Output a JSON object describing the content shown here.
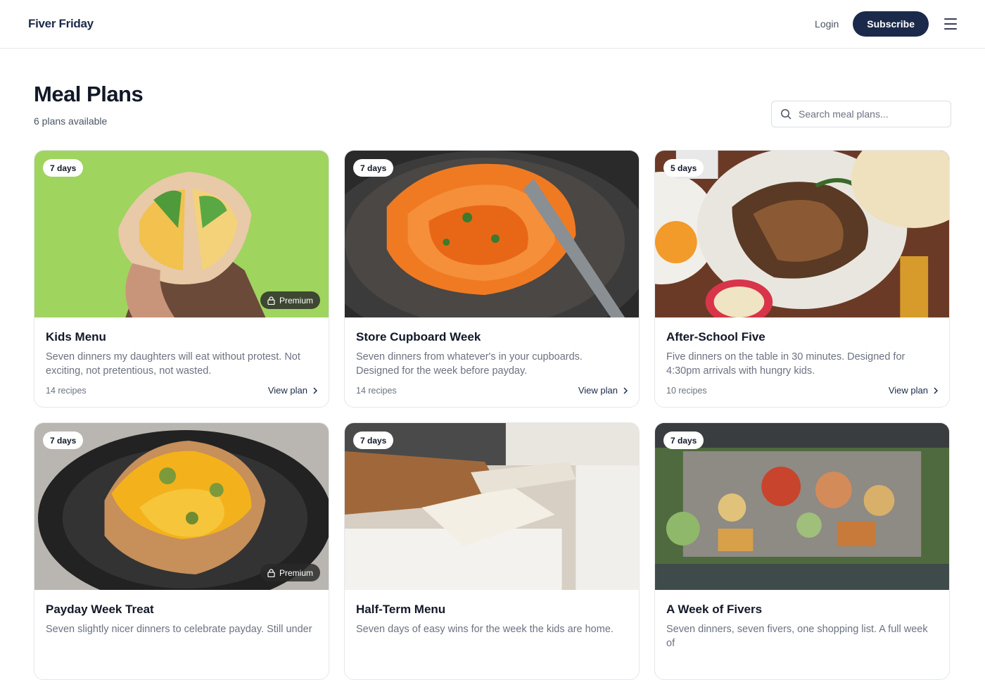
{
  "header": {
    "brand": "Fiver Friday",
    "login_label": "Login",
    "subscribe_label": "Subscribe"
  },
  "page": {
    "title": "Meal Plans",
    "subtitle": "6 plans available"
  },
  "search": {
    "placeholder": "Search meal plans..."
  },
  "plans": [
    {
      "days": "7 days",
      "premium": "Premium",
      "title": "Kids Menu",
      "description": "Seven dinners my daughters will eat without protest. Not exciting, not pretentious, not wasted.",
      "recipes": "14 recipes",
      "cta": "View plan",
      "image": "wrap-sandwich"
    },
    {
      "days": "7 days",
      "title": "Store Cupboard Week",
      "description": "Seven dinners from whatever's in your cupboards. Designed for the week before payday.",
      "recipes": "14 recipes",
      "cta": "View plan",
      "image": "spaghetti-pan"
    },
    {
      "days": "5 days",
      "title": "After-School Five",
      "description": "Five dinners on the table in 30 minutes. Designed for 4:30pm arrivals with hungry kids.",
      "recipes": "10 recipes",
      "cta": "View plan",
      "image": "fajita-platter"
    },
    {
      "days": "7 days",
      "premium": "Premium",
      "title": "Payday Week Treat",
      "description": "Seven slightly nicer dinners to celebrate payday. Still under",
      "image": "cheesy-potato"
    },
    {
      "days": "7 days",
      "title": "Half-Term Menu",
      "description": "Seven days of easy wins for the week the kids are home.",
      "image": "kitchen-cookbook"
    },
    {
      "days": "7 days",
      "title": "A Week of Fivers",
      "description": "Seven dinners, seven fivers, one shopping list. A full week of",
      "image": "feast-table"
    }
  ],
  "colors": {
    "brand_navy": "#1b2a4a",
    "badge_dark": "#282828"
  }
}
